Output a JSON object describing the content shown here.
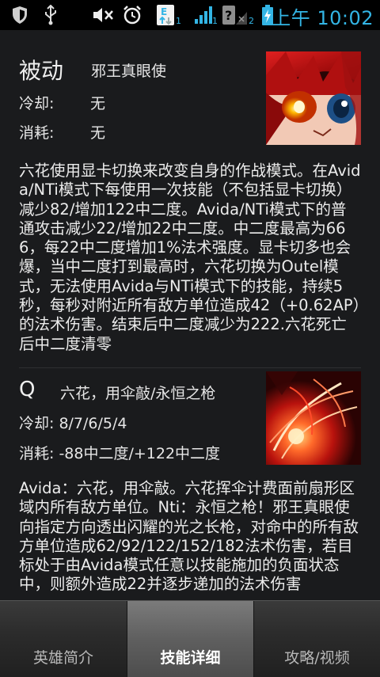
{
  "status_bar": {
    "time": "上午 10:02",
    "sim1_badge": "1",
    "sim2_badge": "2",
    "signal1_badge": "1",
    "icons": [
      "shield-icon",
      "usb-icon",
      "mute-icon",
      "alarm-icon",
      "data-arrows-icon",
      "signal-icon",
      "no-signal-icon",
      "battery-charging-icon"
    ]
  },
  "passive": {
    "label": "被动",
    "name": "邪王真眼使",
    "cooldown_label": "冷却:",
    "cooldown_value": "无",
    "cost_label": "消耗:",
    "cost_value": "无",
    "description": "六花使用显卡切换来改变自身的作战模式。在Avida/NTi模式下每使用一次技能（不包括显卡切换）减少82/增加122中二度。Avida/NTi模式下的普通攻击减少22/增加22中二度。中二度最高为666，每22中二度增加1%法术强度。显卡切多也会爆，当中二度打到最高时，六花切换为Outel模式，无法使用Avida与NTi模式下的技能，持续5秒，每秒对附近所有敌方单位造成42（+0.62AP）的法术伤害。结束后中二度减少为222.六花死亡后中二度清零"
  },
  "q_skill": {
    "key": "Q",
    "name": "六花，用伞敲/永恒之枪",
    "cooldown": "冷却: 8/7/6/5/4",
    "cost": "消耗: -88中二度/+122中二度",
    "description": "Avida：六花，用伞敲。六花挥伞计费面前扇形区域内所有敌方单位。Nti：永恒之枪！邪王真眼使向指定方向透出闪耀的光之长枪，对命中的所有敌方单位造成62/92/122/152/182法术伤害，若目标处于由Avida模式任意以技能施加的负面状态中，则额外造成22并逐步递加的法术伤害"
  },
  "tabs": [
    {
      "label": "英雄简介",
      "active": false
    },
    {
      "label": "技能详细",
      "active": true
    },
    {
      "label": "攻略/视频",
      "active": false
    }
  ]
}
